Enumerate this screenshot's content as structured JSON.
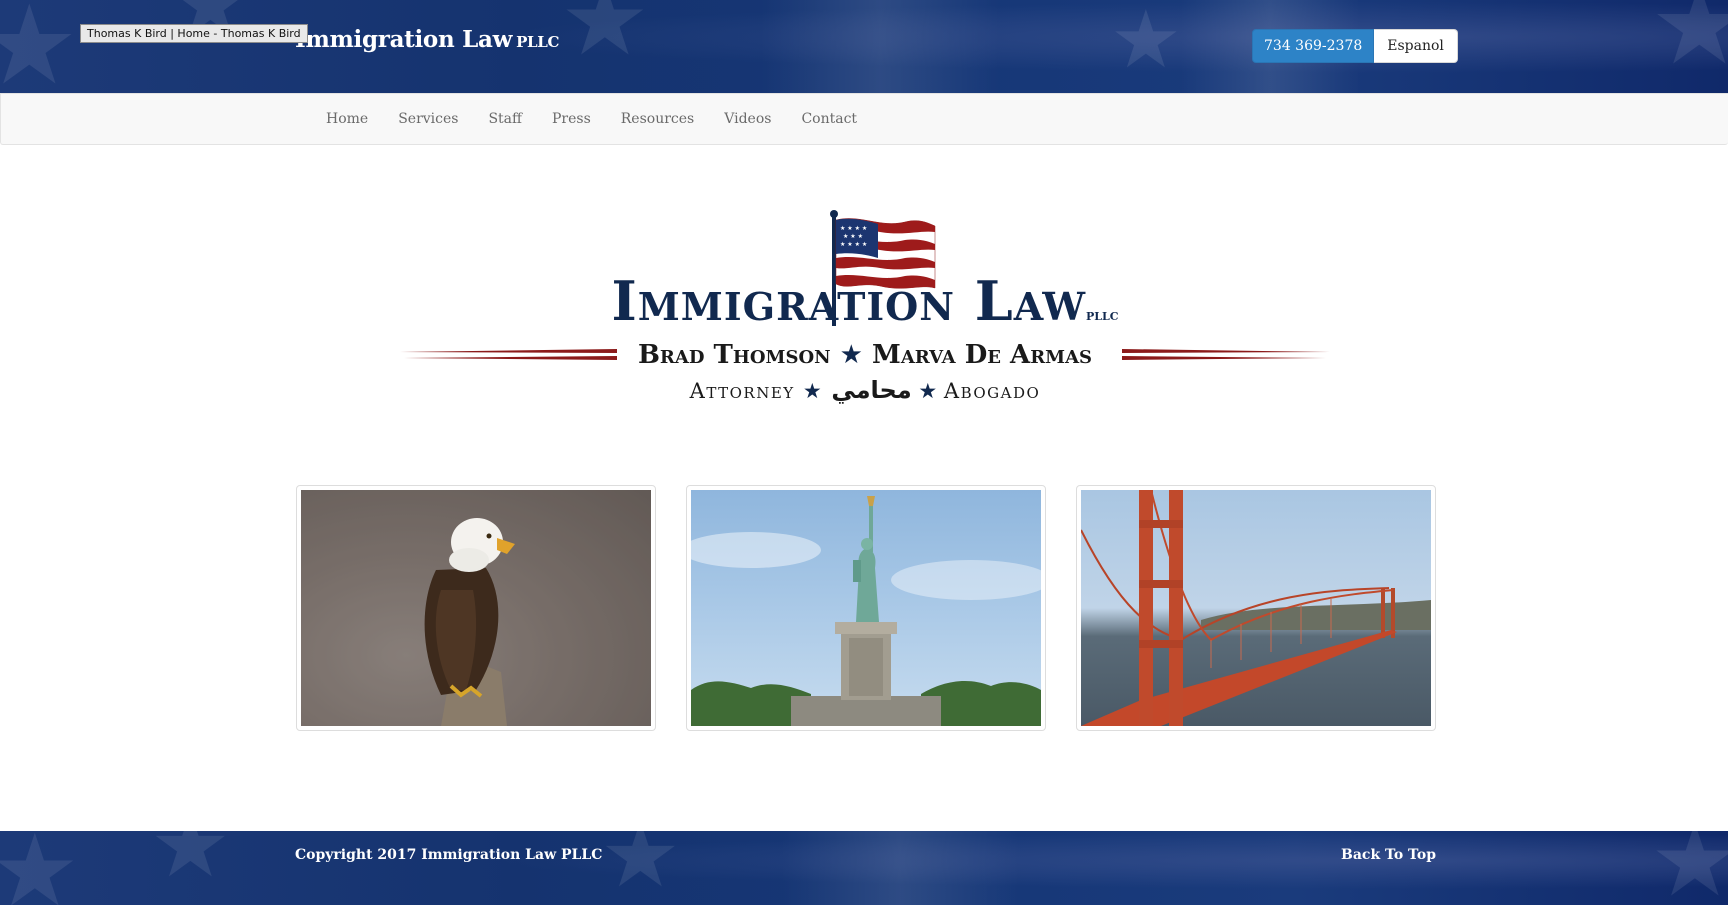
{
  "browser": {
    "tooltip": "Thomas K Bird | Home - Thomas K Bird"
  },
  "header": {
    "brand": "Immigration Law",
    "brand_suffix": "PLLC",
    "phone": "734 369-2378",
    "language": "Espanol"
  },
  "nav": {
    "items": [
      "Home",
      "Services",
      "Staff",
      "Press",
      "Resources",
      "Videos",
      "Contact"
    ]
  },
  "logo": {
    "title": "Immigration Law",
    "title_suffix": "PLLC",
    "name_1": "Brad Thomson",
    "name_2": "Marva De Armas",
    "role_1": "Attorney",
    "role_2": "محامي",
    "role_3": "Abogado",
    "separator": "★"
  },
  "gallery": {
    "images": [
      {
        "subject": "bald eagle"
      },
      {
        "subject": "statue of liberty"
      },
      {
        "subject": "golden gate bridge"
      }
    ]
  },
  "footer": {
    "copyright": "Copyright 2017 Immigration Law PLLC",
    "back_to_top": "Back To Top"
  },
  "colors": {
    "header_blue": "#163777",
    "phone_blue": "#2d83c7",
    "logo_navy": "#11294f",
    "logo_red": "#8b1a1a"
  }
}
